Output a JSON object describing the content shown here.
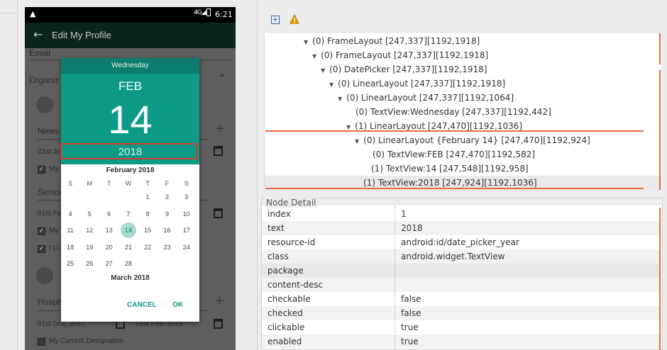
{
  "device": {
    "status_time": "6:21",
    "status_network": "4G",
    "app_title": "Edit My Profile",
    "background": {
      "email_label": "Email",
      "organization_label": "Organiz",
      "news_label": "News",
      "news_from": "01st Ju",
      "my_current_1": "My",
      "senior_label": "Senior",
      "senior_from": "01st Fe",
      "my_current_2": "My",
      "i_cur": "I Cu",
      "hospital_label": "Hospit",
      "hospital_from": "01st Dec, 2017",
      "hospital_to": "01st Feb, 2018",
      "my_current_designation": "My Current Designation"
    },
    "date_picker": {
      "day_of_week": "Wednesday",
      "month": "FEB",
      "date": "14",
      "year": "2018",
      "calendar_title": "February 2018",
      "weekday_headers": [
        "S",
        "M",
        "T",
        "W",
        "T",
        "F",
        "S"
      ],
      "weeks": [
        [
          "",
          "",
          "",
          "",
          "1",
          "2",
          "3"
        ],
        [
          "4",
          "5",
          "6",
          "7",
          "8",
          "9",
          "10"
        ],
        [
          "11",
          "12",
          "13",
          "14",
          "15",
          "16",
          "17"
        ],
        [
          "18",
          "19",
          "20",
          "21",
          "22",
          "23",
          "24"
        ],
        [
          "25",
          "26",
          "27",
          "28",
          "",
          "",
          ""
        ]
      ],
      "selected_day": "14",
      "next_month_title": "March 2018",
      "cancel_label": "CANCEL",
      "ok_label": "OK"
    }
  },
  "toolbar": {
    "expand_icon": "expand-all-icon",
    "warning_icon": "warning-icon",
    "warning_color": "#e8a000"
  },
  "tree": {
    "nodes": [
      {
        "label": "(0) FrameLayout [247,337][1192,1918]"
      },
      {
        "label": "(0) FrameLayout [247,337][1192,1918]"
      },
      {
        "label": "(0) DatePicker [247,337][1192,1918]"
      },
      {
        "label": "(0) LinearLayout [247,337][1192,1918]"
      },
      {
        "label": "(0) LinearLayout [247,337][1192,1064]"
      },
      {
        "label": "(0) TextView:Wednesday [247,337][1192,442]"
      },
      {
        "label": "(1) LinearLayout [247,470][1192,1036]"
      },
      {
        "label": "(0) LinearLayout {February 14} [247,470][1192,924]"
      },
      {
        "label": "(0) TextView:FEB [247,470][1192,582]"
      },
      {
        "label": "(1) TextView:14 [247,548][1192,958]"
      },
      {
        "label": "(1) TextView:2018 [247,924][1192,1036]"
      }
    ],
    "highlight_color": "#e66a3a"
  },
  "node_detail": {
    "title": "Node Detail",
    "properties": [
      {
        "key": "index",
        "value": "1"
      },
      {
        "key": "text",
        "value": "2018"
      },
      {
        "key": "resource-id",
        "value": "android:id/date_picker_year"
      },
      {
        "key": "class",
        "value": "android.widget.TextView"
      },
      {
        "key": "package",
        "value": ""
      },
      {
        "key": "content-desc",
        "value": ""
      },
      {
        "key": "checkable",
        "value": "false"
      },
      {
        "key": "checked",
        "value": "false"
      },
      {
        "key": "clickable",
        "value": "true"
      },
      {
        "key": "enabled",
        "value": "true"
      }
    ]
  }
}
